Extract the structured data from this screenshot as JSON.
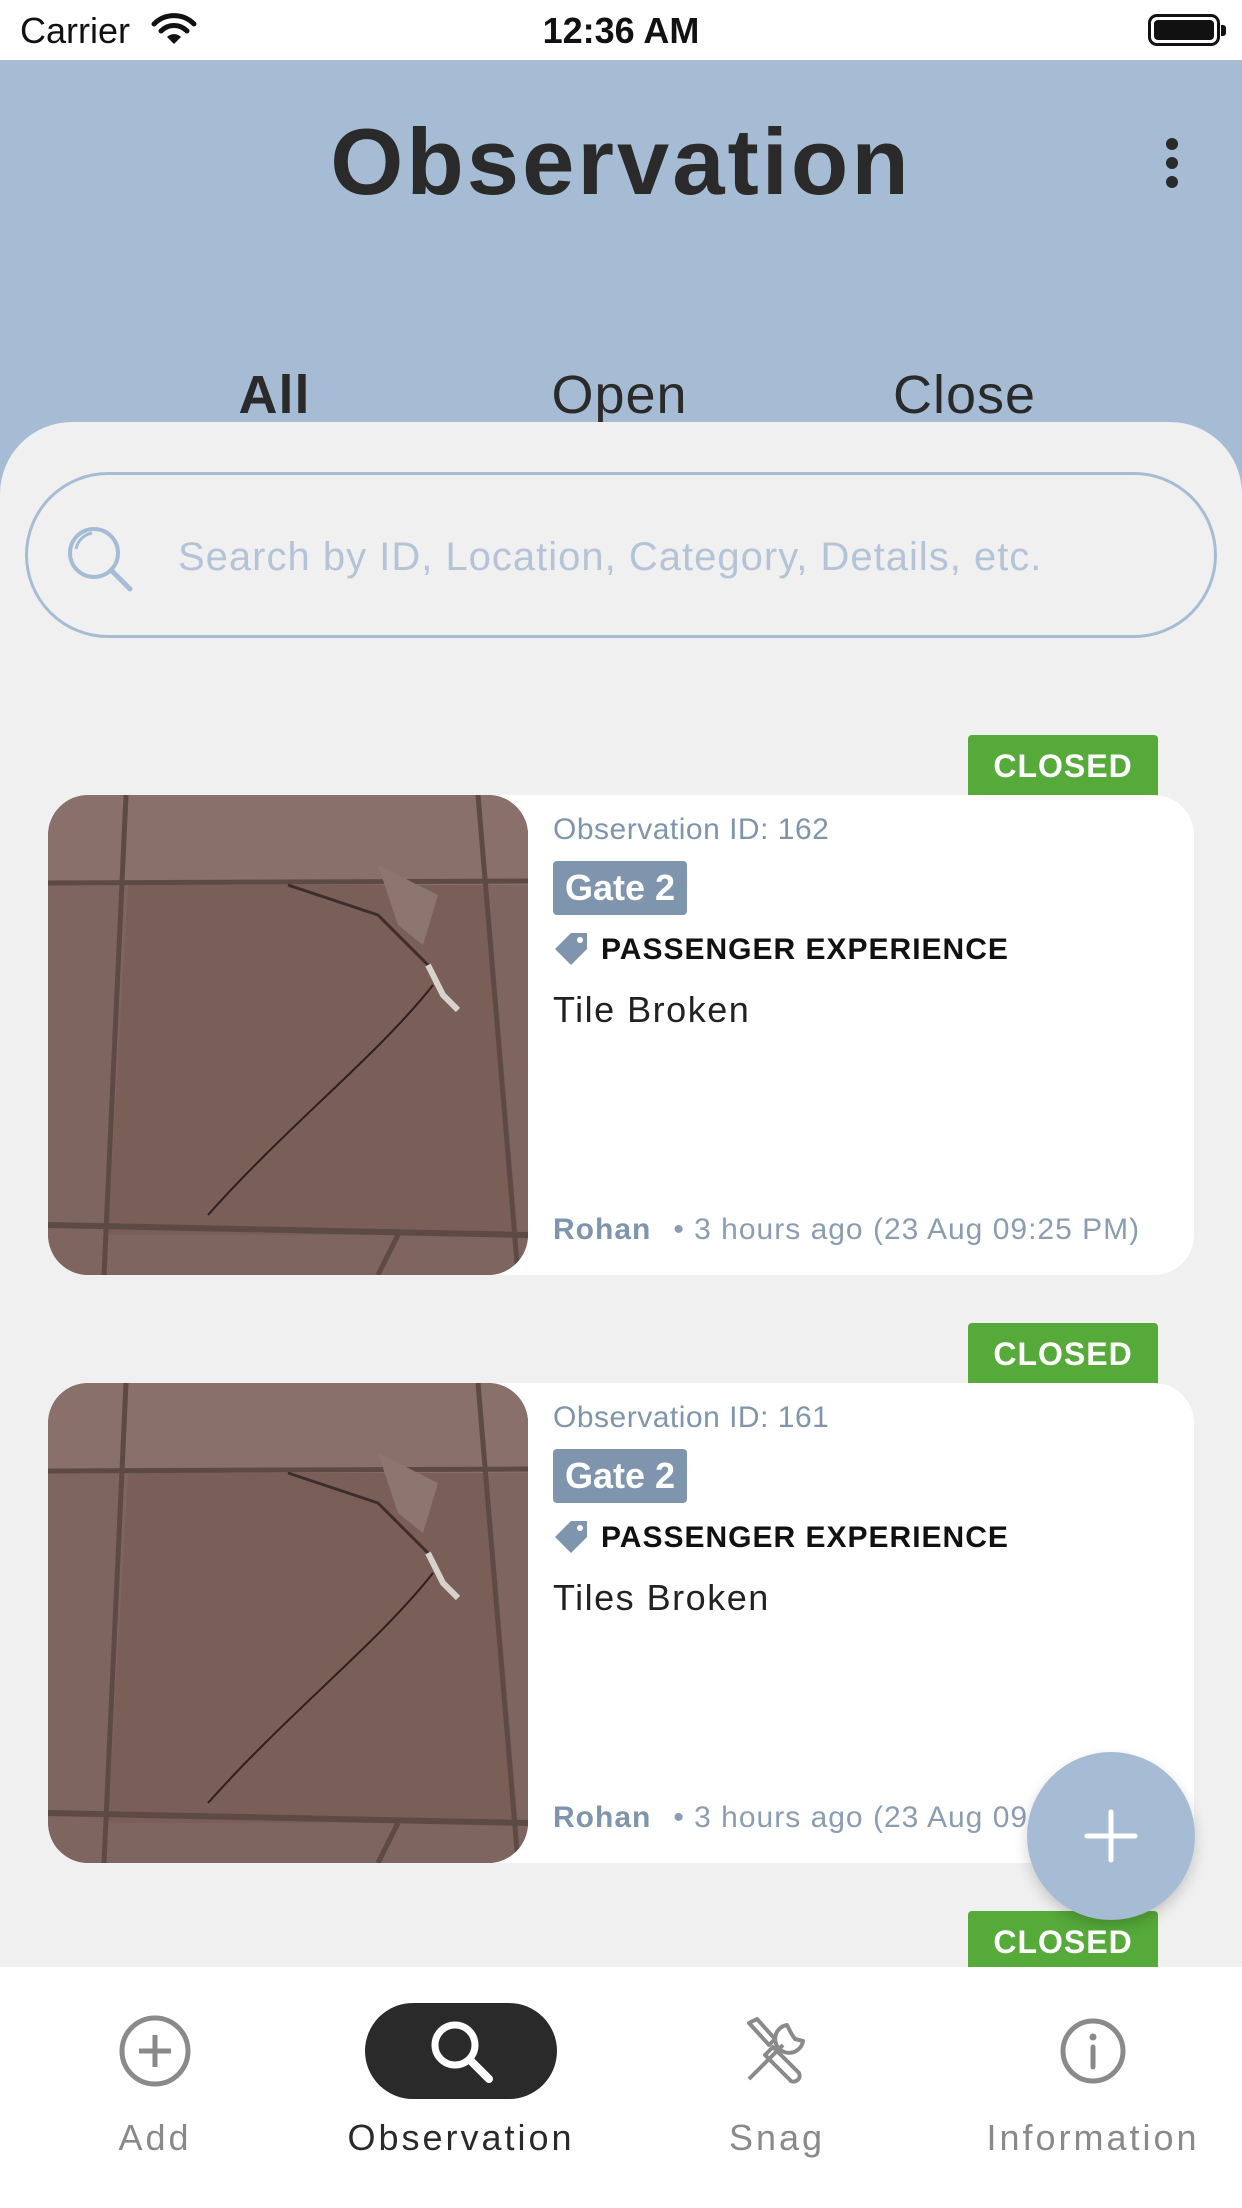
{
  "status_bar": {
    "carrier": "Carrier",
    "time": "12:36 AM"
  },
  "header": {
    "title": "Observation",
    "menu_icon": "more-vertical-icon"
  },
  "tabs": [
    {
      "label": "All",
      "active": true
    },
    {
      "label": "Open",
      "active": false
    },
    {
      "label": "Close",
      "active": false
    }
  ],
  "search": {
    "placeholder": "Search by ID, Location, Category, Details, etc.",
    "value": ""
  },
  "cards": [
    {
      "status": "CLOSED",
      "id_text": "Observation ID: 162",
      "location": "Gate 2",
      "category": "PASSENGER EXPERIENCE",
      "title": "Tile Broken",
      "author": "Rohan",
      "time": "• 3 hours ago (23 Aug 09:25 PM)"
    },
    {
      "status": "CLOSED",
      "id_text": "Observation ID: 161",
      "location": "Gate 2",
      "category": "PASSENGER EXPERIENCE",
      "title": "Tiles Broken",
      "author": "Rohan",
      "time": "• 3 hours ago (23 Aug 09:25 PM)"
    },
    {
      "status": "CLOSED"
    }
  ],
  "bottom_nav": [
    {
      "label": "Add",
      "icon": "add-circle-icon",
      "active": false
    },
    {
      "label": "Observation",
      "icon": "search-icon",
      "active": true
    },
    {
      "label": "Snag",
      "icon": "tools-icon",
      "active": false
    },
    {
      "label": "Information",
      "icon": "info-icon",
      "active": false
    }
  ],
  "colors": {
    "header_bg": "#a6bcd4",
    "accent": "#7f95ad",
    "closed_badge": "#55aa3a",
    "active_nav_pill": "#2a2a2a"
  }
}
